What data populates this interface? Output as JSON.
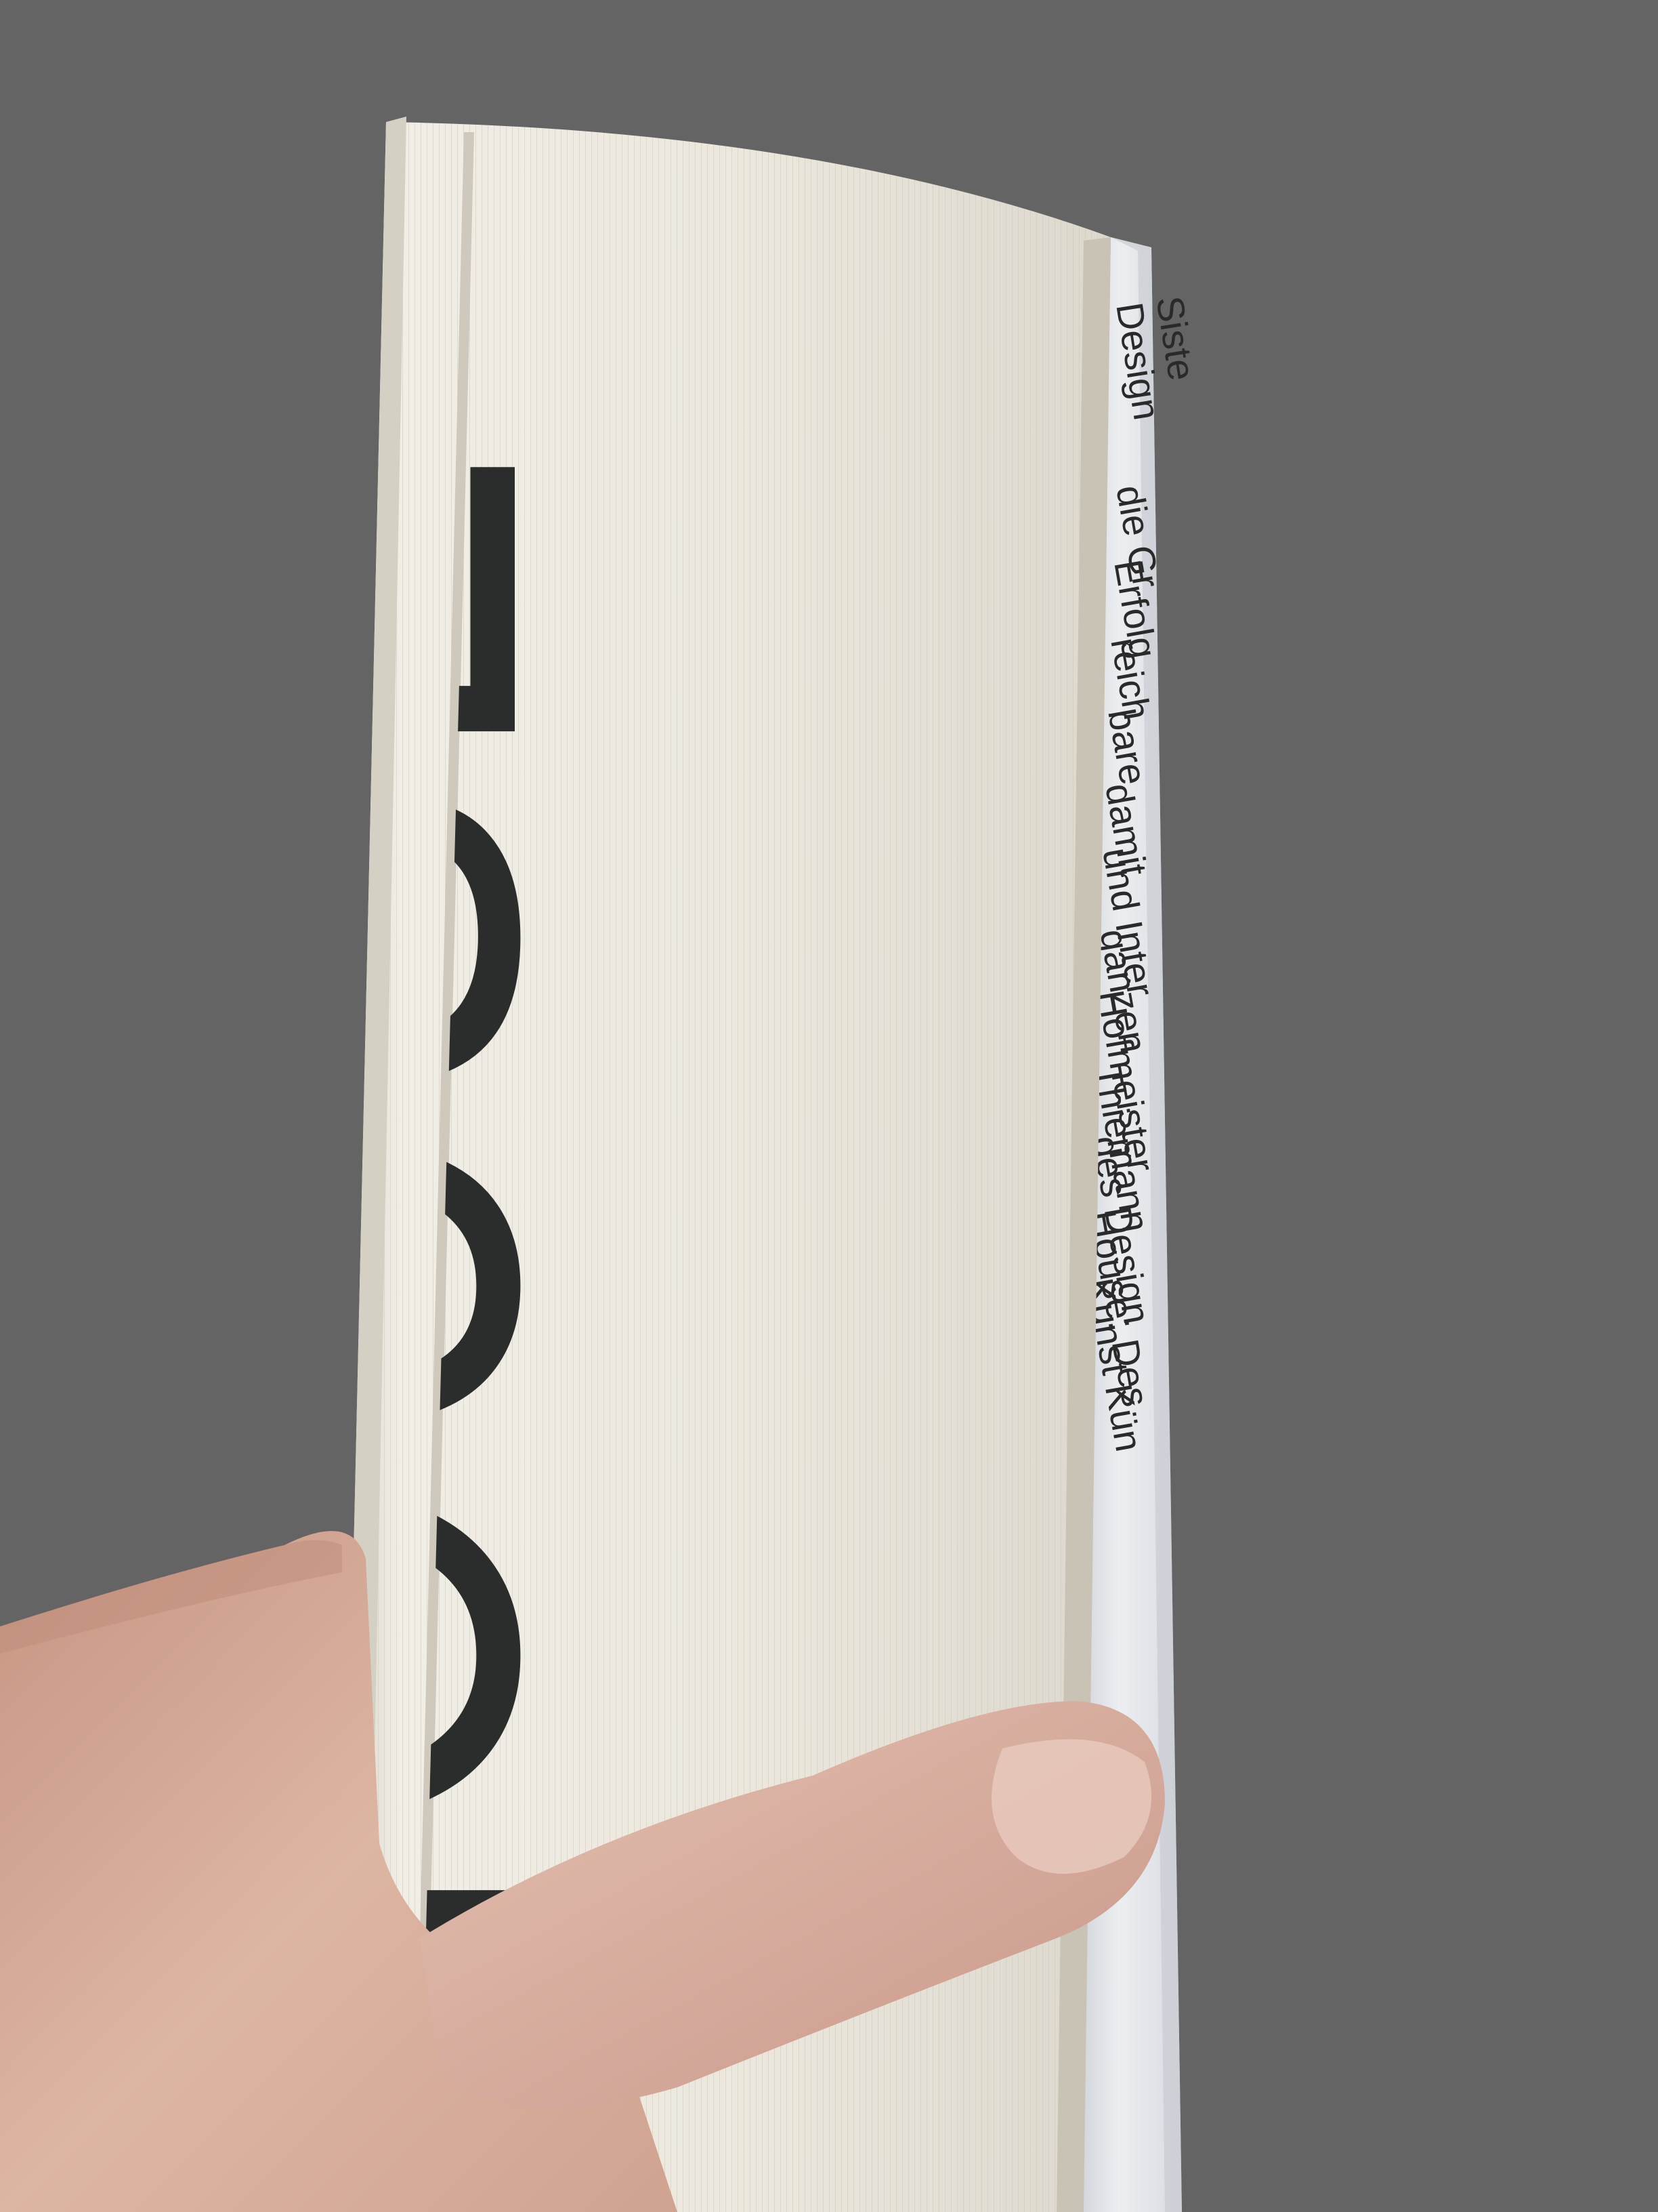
{
  "scene": {
    "description_free_labels": true
  },
  "book": {
    "fore_edge_title": "HOUSE",
    "back_cover_lines": [
      "Design",
      "Siste",
      "die Gr",
      "Erfolg",
      "reich",
      "bare",
      "damit",
      "und Inter",
      "ganzen",
      "Hofmeister",
      "Thiemann",
      "des Design",
      "House: Des",
      "Kunst Kün"
    ]
  },
  "colors": {
    "background": "#656465",
    "page_edge": "#ece8dd",
    "cover_paper": "#e4e6ea",
    "print_ink": "#2b2d2c",
    "skin": "#d9b3a2"
  }
}
